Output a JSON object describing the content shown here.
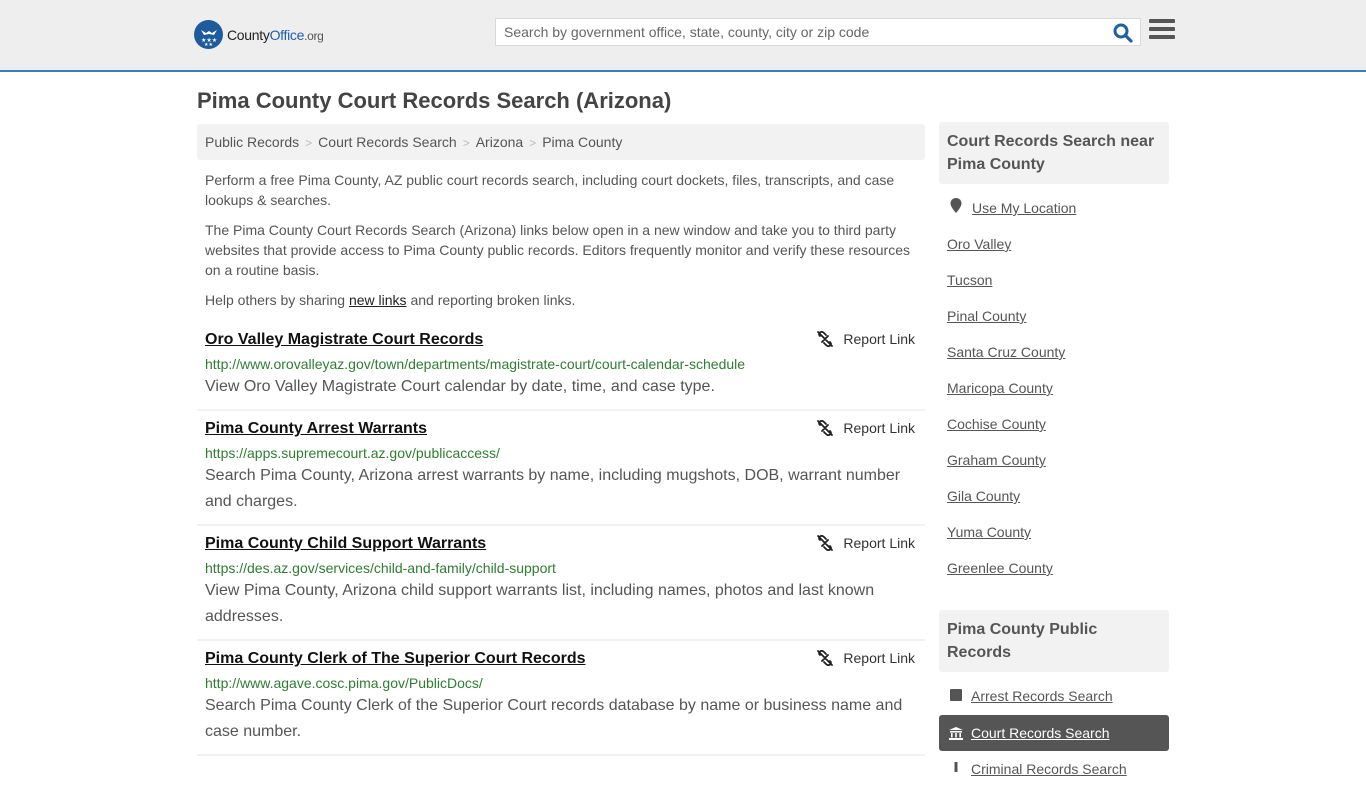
{
  "header": {
    "logo": {
      "name": "County",
      "office": "Office",
      "tld": ".org"
    },
    "search": {
      "placeholder": "Search by government office, state, county, city or zip code",
      "value": ""
    },
    "icons": {
      "search": "search-icon",
      "menu": "hamburger-menu-icon"
    }
  },
  "page": {
    "title": "Pima County Court Records Search (Arizona)",
    "breadcrumb": [
      "Public Records",
      "Court Records Search",
      "Arizona",
      "Pima County"
    ],
    "intro": {
      "p1": "Perform a free Pima County, AZ public court records search, including court dockets, files, transcripts, and case lookups & searches.",
      "p2": "The Pima County Court Records Search (Arizona) links below open in a new window and take you to third party websites that provide access to Pima County public records. Editors frequently monitor and verify these resources on a routine basis.",
      "p3_before": "Help others by sharing ",
      "p3_link": "new links",
      "p3_after": " and reporting broken links."
    }
  },
  "results": [
    {
      "title": "Oro Valley Magistrate Court Records",
      "url": "http://www.orovalleyaz.gov/town/departments/magistrate-court/court-calendar-schedule",
      "description": "View Oro Valley Magistrate Court calendar by date, time, and case type.",
      "report_label": "Report Link"
    },
    {
      "title": "Pima County Arrest Warrants",
      "url": "https://apps.supremecourt.az.gov/publicaccess/",
      "description": "Search Pima County, Arizona arrest warrants by name, including mugshots, DOB, warrant number and charges.",
      "report_label": "Report Link"
    },
    {
      "title": "Pima County Child Support Warrants",
      "url": "https://des.az.gov/services/child-and-family/child-support",
      "description": "View Pima County, Arizona child support warrants list, including names, photos and last known addresses.",
      "report_label": "Report Link"
    },
    {
      "title": "Pima County Clerk of The Superior Court Records",
      "url": "http://www.agave.cosc.pima.gov/PublicDocs/",
      "description": "Search Pima County Clerk of the Superior Court records database by name or business name and case number.",
      "report_label": "Report Link"
    }
  ],
  "sidebar": {
    "nearby_heading": "Court Records Search near Pima County",
    "use_location": "Use My Location",
    "nearby": [
      "Oro Valley",
      "Tucson",
      "Pinal County",
      "Santa Cruz County",
      "Maricopa County",
      "Cochise County",
      "Graham County",
      "Gila County",
      "Yuma County",
      "Greenlee County"
    ],
    "records_heading": "Pima County Public Records",
    "records": [
      {
        "label": "Arrest Records Search",
        "icon": "square-icon",
        "active": false
      },
      {
        "label": "Court Records Search",
        "icon": "courthouse-icon",
        "active": true
      },
      {
        "label": "Criminal Records Search",
        "icon": "exclamation-icon",
        "active": false
      }
    ]
  },
  "colors": {
    "accent": "#3d7eb5",
    "brand": "#1f5fa8",
    "url_green": "#2e7d32",
    "active_bg": "#555555"
  }
}
